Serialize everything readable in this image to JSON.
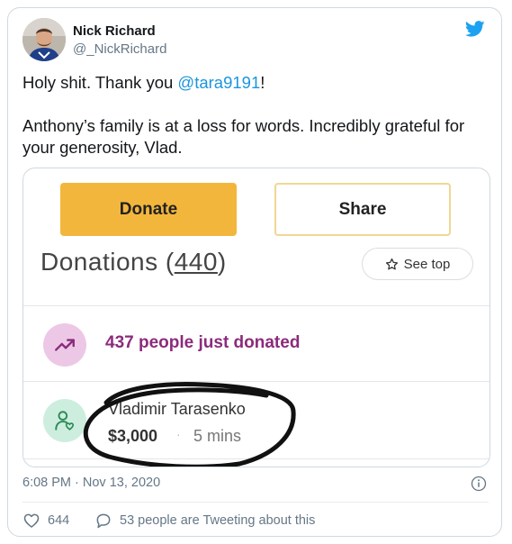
{
  "tweet": {
    "author_name": "Nick Richard",
    "author_handle": "@_NickRichard",
    "text_line1_prefix": "Holy shit. Thank you ",
    "text_line1_mention": "@tara9191",
    "text_line1_suffix": "!",
    "text_paragraph2": "Anthony’s family is at a loss for words. Incredibly grateful for your generosity, Vlad.",
    "timestamp": "6:08 PM · Nov 13, 2020",
    "likes_count": "644",
    "reply_text": "53 people are Tweeting about this",
    "brand_color": "#1da1f2",
    "icons": [
      "twitter-bird-icon",
      "info-icon",
      "heart-icon",
      "comment-icon"
    ]
  },
  "media": {
    "donate_label": "Donate",
    "share_label": "Share",
    "donations_word": "Donations (",
    "donations_count": "440",
    "donations_close": ")",
    "see_top_label": "See top",
    "trend_text": "437 people just donated",
    "donor_name": "Vladimir Tarasenko",
    "donor_amount": "$3,000",
    "donor_dot": "·",
    "donor_time": "5 mins",
    "donate_color": "#f3b63d",
    "trend_color": "#8b2b7b",
    "icons": [
      "star-icon",
      "trending-up-icon",
      "donor-heart-person-icon"
    ]
  }
}
